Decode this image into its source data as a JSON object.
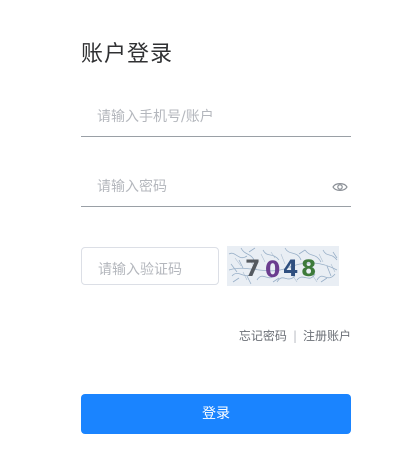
{
  "login": {
    "title": "账户登录",
    "account_placeholder": "请输入手机号/账户",
    "password_placeholder": "请输入密码",
    "captcha_placeholder": "请输入验证码",
    "captcha_text": "7048",
    "forgot_label": "忘记密码",
    "separator": "|",
    "register_label": "注册账户",
    "submit_label": "登录"
  },
  "icons": {
    "password_toggle": "eye-icon"
  },
  "colors": {
    "primary": "#1a84ff",
    "text": "#303133",
    "placeholder": "#b4b7bd",
    "link": "#6b6f76"
  }
}
